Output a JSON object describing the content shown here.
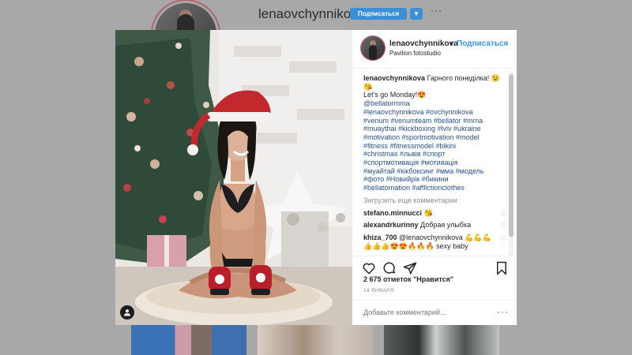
{
  "profile": {
    "username": "lenaovchynnikova",
    "follow_label": "Подписаться",
    "more_label": "···"
  },
  "post": {
    "username": "lenaovchynnikova",
    "separator": "•",
    "follow_label": "Подписаться",
    "location": "Pavilion fotostudio",
    "caption": {
      "user": "lenaovchynnikova",
      "text": "Гарного понеділка! 😉😘",
      "line2": "Let's go Monday!😍",
      "hashtags": [
        "@bellatormma",
        "#lenaovchynnikova #ovchynnikova",
        "#venum #venumteam #bellator #mma",
        "#muaythai #kickboxing #lviv #ukraine",
        "#motivation #sportmotivation #model",
        "#fitness #fitnessmodel #bikini",
        "#christmas #львів #спорт",
        "#спортмотивація #мотивація",
        "#муайтай #кікбоксинг #мма #модель",
        "#фото #Новийрік #бикини",
        "#bellatornation #afflictionclothes"
      ]
    },
    "load_more": "Загрузить еще комментарии",
    "comments": [
      {
        "user": "stefano.minnucci",
        "text": "😘"
      },
      {
        "user": "alexandrkurinny",
        "text": "Добрая улыбка"
      },
      {
        "user": "khiza_700",
        "text": "@lenaovchynnikova 💪💪💪👍👍👍😍😍🔥🔥🔥 sexy baby"
      }
    ],
    "likes": "2 675 отметок \"Нравится\"",
    "date": "14 ЯНВАРЯ",
    "comment_placeholder": "Добавьте комментарий...",
    "comment_more": "···"
  },
  "icons": {
    "tag_users": "user-tag-icon",
    "like": "heart-icon",
    "comment": "comment-bubble-icon",
    "share": "share-arrow-icon",
    "save": "bookmark-icon",
    "comment_like": "small-heart-icon",
    "dropdown": "chevron-down-icon"
  },
  "colors": {
    "accent": "#3897f0",
    "follow_button": "#3a8fd6",
    "overlay": "#a8a8a8",
    "hashtag": "#2b4f8c"
  }
}
